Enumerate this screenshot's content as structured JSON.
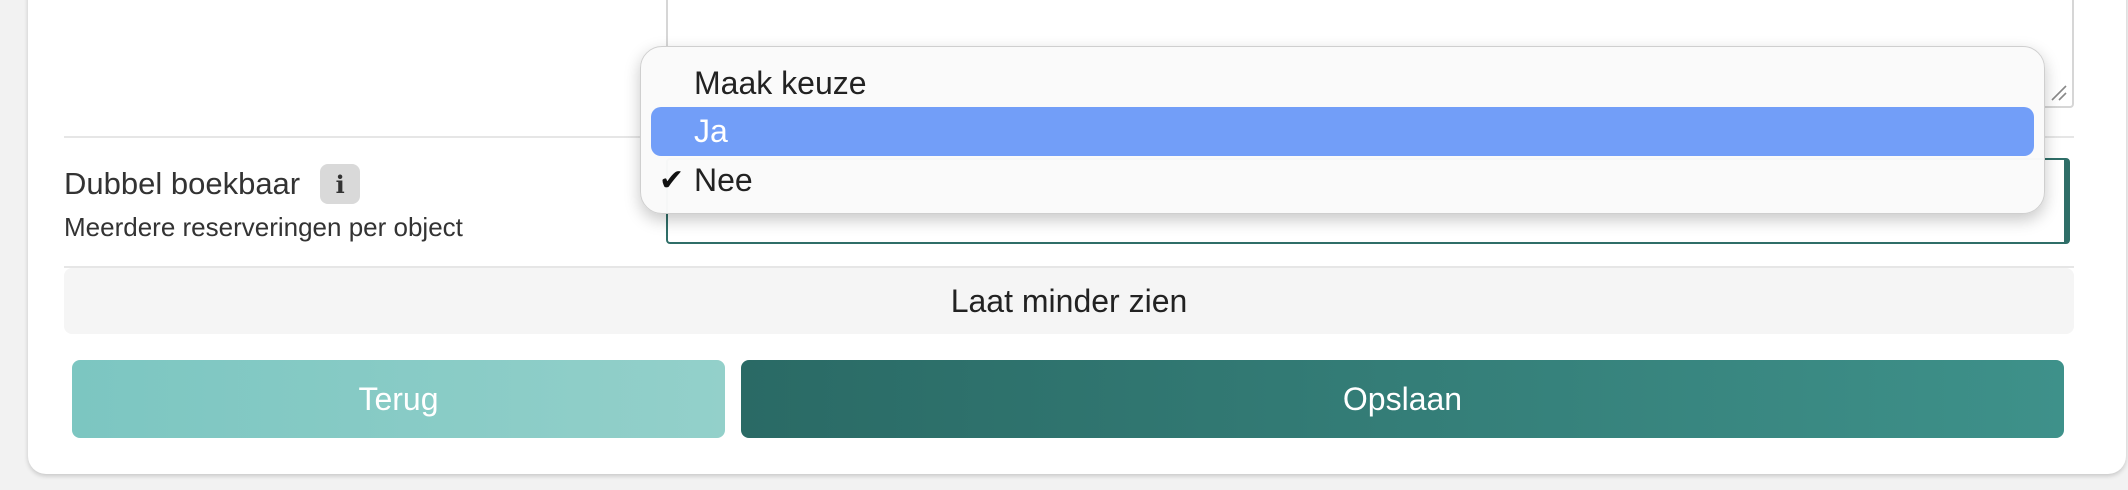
{
  "form": {
    "double_bookable": {
      "label": "Dubbel boekbaar",
      "description": "Meerdere reserveringen per object",
      "info_icon": "info-icon"
    },
    "dropdown": {
      "options": [
        {
          "label": "Maak keuze",
          "checked": false,
          "highlighted": false
        },
        {
          "label": "Ja",
          "checked": false,
          "highlighted": true
        },
        {
          "label": "Nee",
          "checked": true,
          "highlighted": false
        }
      ],
      "check_glyph": "✔"
    },
    "toggle_less_label": "Laat minder zien"
  },
  "buttons": {
    "back_label": "Terug",
    "save_label": "Opslaan"
  },
  "colors": {
    "accent": "#2f6e68",
    "save_button": "#35807a",
    "back_button": "#85cac4",
    "dropdown_highlight": "#729ef8"
  }
}
